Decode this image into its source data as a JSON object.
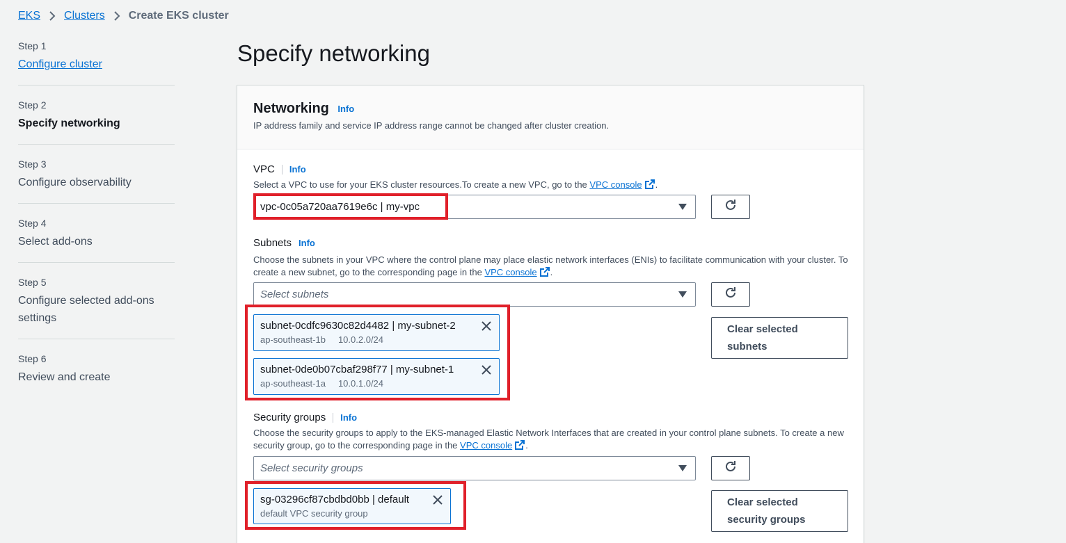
{
  "breadcrumb": {
    "root": "EKS",
    "clusters": "Clusters",
    "current": "Create EKS cluster"
  },
  "steps": [
    {
      "num": "Step 1",
      "label": "Configure cluster"
    },
    {
      "num": "Step 2",
      "label": "Specify networking"
    },
    {
      "num": "Step 3",
      "label": "Configure observability"
    },
    {
      "num": "Step 4",
      "label": "Select add-ons"
    },
    {
      "num": "Step 5",
      "label": "Configure selected add-ons settings"
    },
    {
      "num": "Step 6",
      "label": "Review and create"
    }
  ],
  "page_title": "Specify networking",
  "networking": {
    "title": "Networking",
    "info": "Info",
    "desc": "IP address family and service IP address range cannot be changed after cluster creation."
  },
  "vpc": {
    "label": "VPC",
    "info": "Info",
    "desc_pre": "Select a VPC to use for your EKS cluster resources.To create a new VPC, go to the ",
    "link": "VPC console",
    "desc_post": ".",
    "value": "vpc-0c05a720aa7619e6c | my-vpc"
  },
  "subnets": {
    "label": "Subnets",
    "info": "Info",
    "desc_pre": "Choose the subnets in your VPC where the control plane may place elastic network interfaces (ENIs) to facilitate communication with your cluster. To create a new subnet, go to the corresponding page in the ",
    "link": "VPC console",
    "desc_post": ".",
    "placeholder": "Select subnets",
    "selected": [
      {
        "name": "subnet-0cdfc9630c82d4482 | my-subnet-2",
        "az": "ap-southeast-1b",
        "cidr": "10.0.2.0/24"
      },
      {
        "name": "subnet-0de0b07cbaf298f77 | my-subnet-1",
        "az": "ap-southeast-1a",
        "cidr": "10.0.1.0/24"
      }
    ],
    "clear_label": "Clear selected subnets"
  },
  "security_groups": {
    "label": "Security groups",
    "info": "Info",
    "desc_pre": "Choose the security groups to apply to the EKS-managed Elastic Network Interfaces that are created in your control plane subnets. To create a new security group, go to the corresponding page in the ",
    "link": "VPC console",
    "desc_post": ".",
    "placeholder": "Select security groups",
    "selected": [
      {
        "name": "sg-03296cf87cbdbd0bb | default",
        "desc": "default VPC security group"
      }
    ],
    "clear_label": "Clear selected security groups"
  },
  "colors": {
    "link": "#0972d3",
    "highlight": "#e0202a",
    "token_bg": "#f2f8fd"
  },
  "icons": [
    "chevron-right-icon",
    "external-link-icon",
    "caret-down-icon",
    "refresh-icon",
    "close-icon"
  ]
}
